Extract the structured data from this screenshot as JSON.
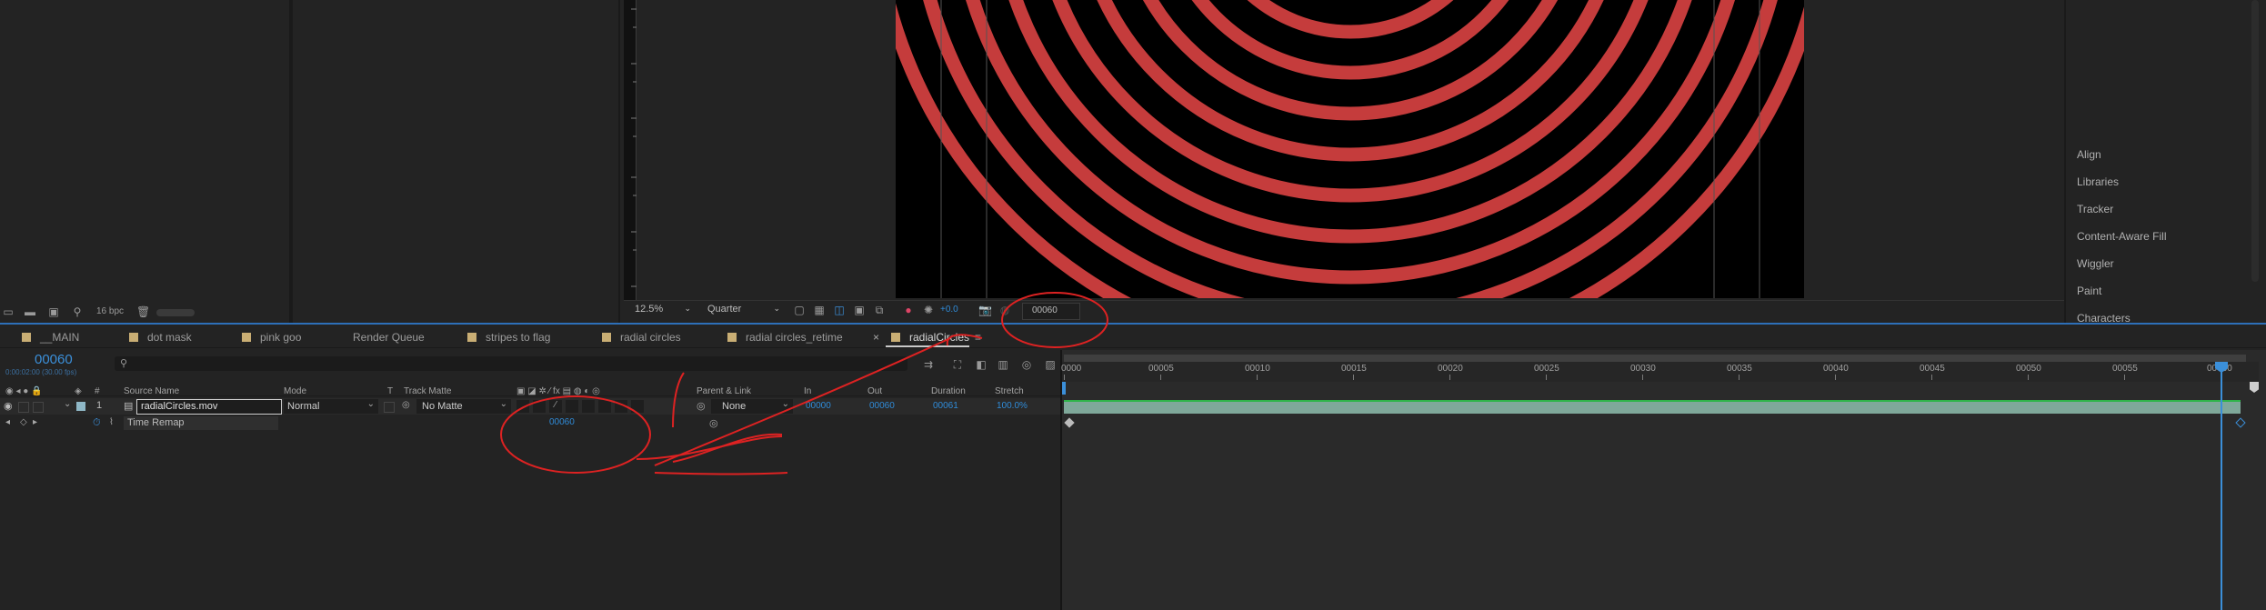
{
  "viewer": {
    "zoom": "12.5%",
    "resolution": "Quarter",
    "exposure": "+0.0",
    "current_frame": "00060",
    "bpc": "16 bpc"
  },
  "side_panels": [
    "Align",
    "Libraries",
    "Tracker",
    "Content-Aware Fill",
    "Wiggler",
    "Paint",
    "Characters"
  ],
  "tabs": [
    {
      "label": "__MAIN",
      "color": "#c9ae74"
    },
    {
      "label": "dot mask",
      "color": "#c9ae74"
    },
    {
      "label": "pink goo",
      "color": "#c9ae74"
    },
    {
      "label": "Render Queue",
      "color": ""
    },
    {
      "label": "stripes to flag",
      "color": "#c9ae74"
    },
    {
      "label": "radial circles",
      "color": "#c9ae74"
    },
    {
      "label": "radial circles_retime",
      "color": "#c9ae74"
    },
    {
      "label": "radialCircles",
      "color": "#c9ae74",
      "active": true
    }
  ],
  "timeline": {
    "timecode": "00060",
    "timecode_sub": "0:00:02:00 (30.00 fps)",
    "search_placeholder": "",
    "columns": {
      "num": "#",
      "source": "Source Name",
      "mode": "Mode",
      "t": "T",
      "track_matte": "Track Matte",
      "parent": "Parent & Link",
      "in": "In",
      "out": "Out",
      "duration": "Duration",
      "stretch": "Stretch"
    },
    "layer": {
      "number": "1",
      "name": "radialCircles.mov",
      "mode": "Normal",
      "matte": "No Matte",
      "parent": "None",
      "in": "00000",
      "out": "00060",
      "duration": "00061",
      "stretch": "100.0%"
    },
    "property": {
      "name": "Time Remap",
      "value": "00060"
    },
    "ruler": [
      "0000",
      "00005",
      "00010",
      "00015",
      "00020",
      "00025",
      "00030",
      "00035",
      "00040",
      "00045",
      "00050",
      "00055",
      "00060"
    ]
  }
}
